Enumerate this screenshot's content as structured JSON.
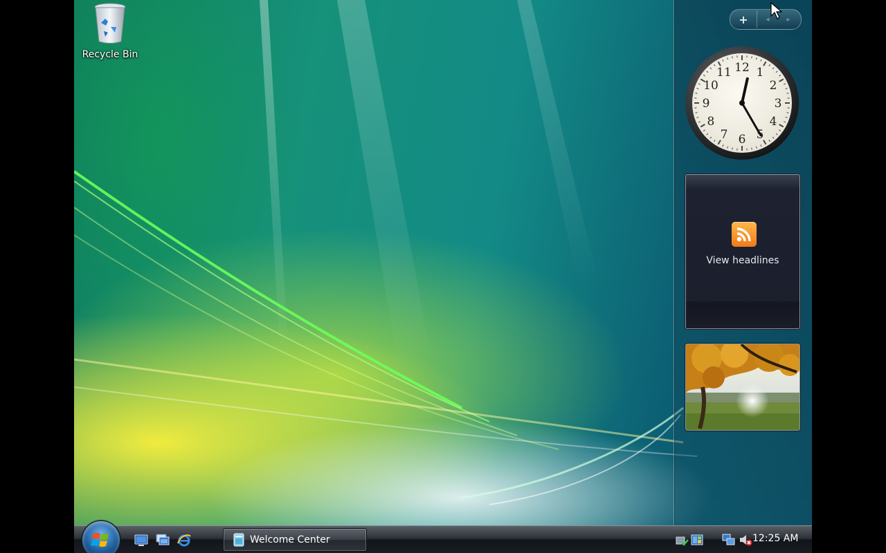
{
  "desktop": {
    "icons": [
      {
        "label": "Recycle Bin",
        "icon": "recycle-bin-icon"
      }
    ]
  },
  "sidebar": {
    "add_label": "+",
    "prev_label": "◂",
    "next_label": "▸",
    "clock": {
      "numerals": [
        "12",
        "1",
        "2",
        "3",
        "4",
        "5",
        "6",
        "7",
        "8",
        "9",
        "10",
        "11"
      ],
      "time": {
        "hour": 12,
        "minute": 25
      }
    },
    "feed": {
      "label": "View headlines",
      "icon": "rss-icon"
    },
    "slideshow": {
      "icon": "autumn-tree-photo"
    }
  },
  "taskbar": {
    "start": {
      "icon": "windows-logo-icon"
    },
    "quick_launch": [
      {
        "icon": "show-desktop-icon"
      },
      {
        "icon": "switch-windows-icon"
      },
      {
        "icon": "internet-explorer-icon"
      }
    ],
    "tasks": [
      {
        "label": "Welcome Center",
        "icon": "welcome-center-icon"
      }
    ],
    "tray": {
      "icons": [
        "network-check-icon",
        "windows-sidebar-icon",
        "network-icon",
        "volume-muted-icon"
      ],
      "time": "12:25 AM"
    }
  },
  "colors": {
    "rss": "#f27a1a",
    "taskbar": "#1a1e24",
    "clock_face": "#f4f1e6"
  }
}
